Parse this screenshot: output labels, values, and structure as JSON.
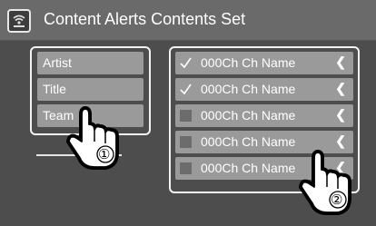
{
  "header": {
    "title": "Content Alerts Contents Set"
  },
  "left_list": {
    "items": [
      {
        "label": "Artist"
      },
      {
        "label": "Title"
      },
      {
        "label": "Team"
      }
    ]
  },
  "right_list": {
    "items": [
      {
        "label": "000Ch Ch Name",
        "checked": true
      },
      {
        "label": "000Ch Ch Name",
        "checked": true
      },
      {
        "label": "000Ch Ch Name",
        "checked": false
      },
      {
        "label": "000Ch Ch Name",
        "checked": false
      },
      {
        "label": "000Ch Ch Name",
        "checked": false
      }
    ],
    "chevron": "❮"
  },
  "callouts": {
    "one": "①",
    "two": "②"
  },
  "colors": {
    "background": "#4d4d4d",
    "item": "#9a9a9a",
    "titlebar": "#6a6a6a",
    "border": "#f2f2f2"
  },
  "icons": {
    "app": "content-alert-icon",
    "check": "checkmark-icon",
    "chevron": "chevron-left-icon",
    "hand": "pointing-hand-icon"
  }
}
